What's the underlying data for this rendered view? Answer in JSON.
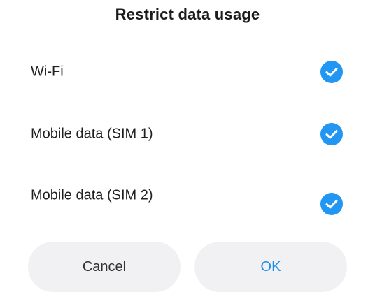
{
  "dialog": {
    "title": "Restrict data usage",
    "options": [
      {
        "label": "Wi-Fi",
        "checked": true
      },
      {
        "label": "Mobile data (SIM 1)",
        "checked": true
      },
      {
        "label": "Mobile data (SIM 2)",
        "checked": true
      }
    ],
    "buttons": {
      "cancel_label": "Cancel",
      "ok_label": "OK"
    }
  },
  "colors": {
    "accent": "#2196f3",
    "ok_text": "#1a8fe8",
    "button_bg": "#f1f1f3"
  },
  "icons": {
    "checkbox": "checkmark-circle-icon"
  }
}
